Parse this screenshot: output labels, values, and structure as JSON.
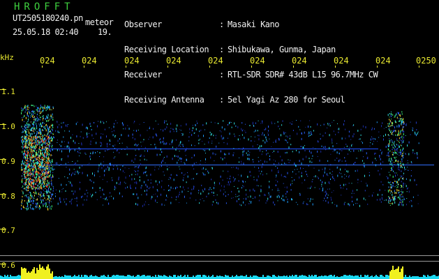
{
  "app": {
    "title": "HROFFT"
  },
  "file": {
    "name": "UT2505180240.pn",
    "tag": "meteor",
    "datetime": "25.05.18 02:40",
    "count": "19."
  },
  "station": {
    "labels": [
      "Observer",
      "Receiving Location",
      "Receiver",
      "Receiving Antenna"
    ],
    "colons": [
      ":",
      ":",
      ":",
      ":"
    ],
    "values": [
      "Masaki Kano",
      "Shibukawa, Gunma, Japan",
      "RTL-SDR SDR# 43dB L15 96.7MHz CW",
      "5el Yagi Az 280 for Seoul"
    ]
  },
  "axes": {
    "y_unit": "kHz",
    "y_ticks": [
      "1.1",
      "1.0",
      "0.9",
      "0.8",
      "0.7",
      "0.6"
    ],
    "x_ticks": [
      "024",
      "024",
      "024",
      "024",
      "024",
      "024",
      "024",
      "024",
      "024",
      "0250"
    ]
  },
  "colors": {
    "title": "#3fd13f",
    "axis_labels": "#e8e830",
    "header_text": "#f0f0f0",
    "noise_floor": "#1ad8f0",
    "echo_peak": "#ff3030"
  }
}
